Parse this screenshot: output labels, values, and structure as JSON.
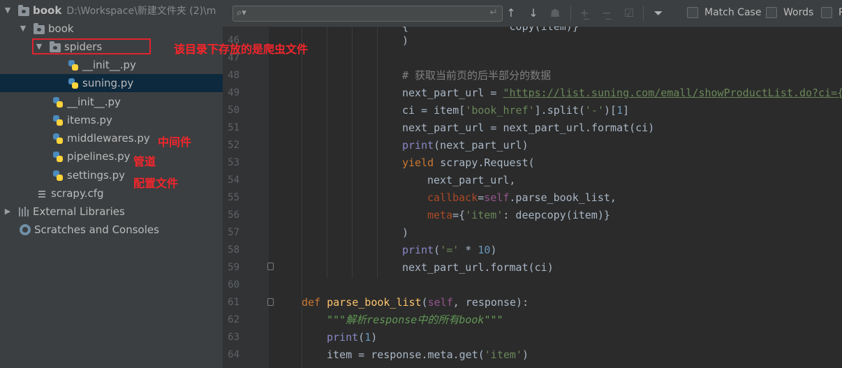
{
  "tree": {
    "root_label": "book",
    "root_path": "D:\\Workspace\\新建文件夹 (2)\\m",
    "package_label": "book",
    "spiders_label": "spiders",
    "spiders_init": "__init__.py",
    "suning_file": "suning.py",
    "pkg_init": "__init__.py",
    "items_file": "items.py",
    "middlewares_file": "middlewares.py",
    "pipelines_file": "pipelines.py",
    "settings_file": "settings.py",
    "cfg_file": "scrapy.cfg",
    "external_libraries": "External Libraries",
    "scratches": "Scratches and Consoles"
  },
  "annotations": {
    "spiders_note": "该目录下存放的是爬虫文件",
    "middlewares_note": "中间件",
    "pipelines_note": "管道",
    "settings_note": "配置文件"
  },
  "find_bar": {
    "match_case": "Match Case",
    "words": "Words",
    "regex_partial": "R"
  },
  "editor": {
    "line_numbers": [
      "46",
      "47",
      "48",
      "49",
      "50",
      "51",
      "52",
      "53",
      "54",
      "55",
      "56",
      "57",
      "58",
      "59",
      "60",
      "61",
      "62",
      "63",
      "64"
    ],
    "lines": {
      "l45": "{",
      "l45b": "copy(item)}",
      "l46": ")",
      "l48": "# 获取当前页的后半部分的数据",
      "l49a": "next_part_url = ",
      "l49url": "\"https://list.suning.com/emall/showProductList.do?ci={",
      "l50a": "ci = item[",
      "l50s": "'book_href'",
      "l50b": "].split(",
      "l50s2": "'-'",
      "l50c": ")[",
      "l50n": "1",
      "l50d": "]",
      "l51": "next_part_url = next_part_url.format(ci)",
      "l52a": "print",
      "l52b": "(next_part_url)",
      "l53a": "yield ",
      "l53b": "scrapy.Request(",
      "l54": "next_part_url,",
      "l55p": "callback",
      "l55a": "=",
      "l55s": "self",
      "l55b": ".parse_book_list,",
      "l56p": "meta",
      "l56a": "={",
      "l56s": "'item'",
      "l56b": ": deepcopy(item)}",
      "l57": ")",
      "l58a": "print",
      "l58b": "(",
      "l58s": "'='",
      "l58c": " * ",
      "l58n": "10",
      "l58d": ")",
      "l59": "next_part_url.format(ci)",
      "l61k": "def ",
      "l61f": "parse_book_list",
      "l61a": "(",
      "l61s": "self",
      "l61b": ", response):",
      "l62": "\"\"\"解析response中的所有book\"\"\"",
      "l63a": "print",
      "l63b": "(",
      "l63n": "1",
      "l63c": ")",
      "l64a": "item = response.meta.get(",
      "l64s": "'item'",
      "l64b": ")"
    }
  },
  "colors": {
    "annotation_red": "#f0262c",
    "editor_bg": "#2b2b2b",
    "tree_bg": "#3c3f41",
    "selection": "#0d293e"
  }
}
